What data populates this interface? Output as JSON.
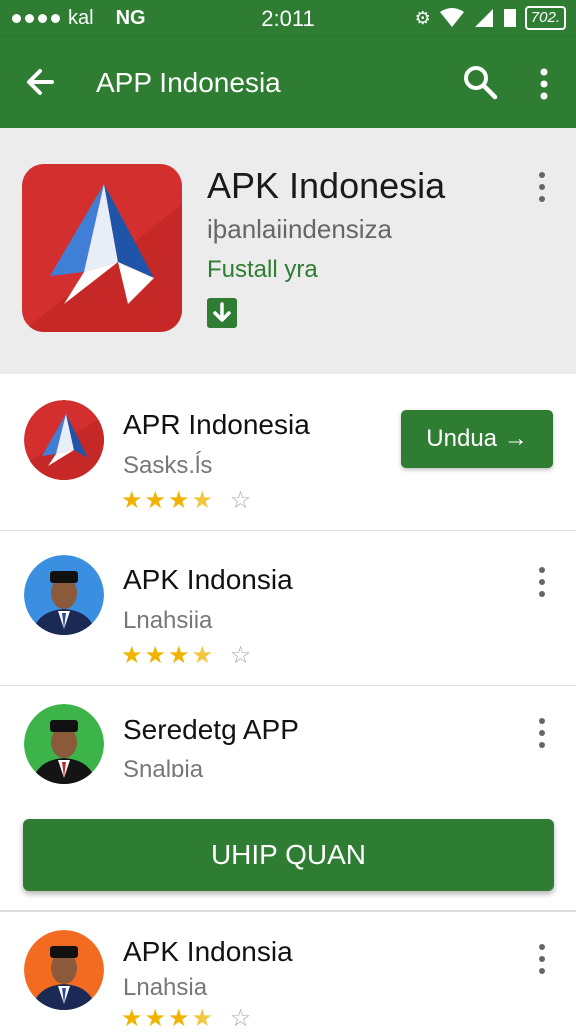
{
  "status_bar": {
    "carrier": "kal",
    "network": "NG",
    "time": "2:011",
    "battery": "702."
  },
  "app_bar": {
    "title": "APP Indonesia",
    "back_icon": "arrow-left-icon",
    "search_icon": "search-icon",
    "more_icon": "more-vert-icon"
  },
  "hero": {
    "name": "APK Indonesia",
    "subtitle": "iþanlaiindensiza",
    "installed_text": "Fustall yra",
    "download_icon": "download-icon"
  },
  "items": [
    {
      "name": "APR Indonesia",
      "subtitle": "Sasks.ĺs",
      "rating": 3.5,
      "button_label": "Undua →"
    },
    {
      "name": "APK Indonsia",
      "subtitle": "Lnahsiia",
      "rating": 3.5
    },
    {
      "name": "Seredetg APP",
      "subtitle": "Snalɒia"
    },
    {
      "name": "APK Indonsia",
      "subtitle": "Lnahsia",
      "rating": 3.5
    }
  ],
  "big_button": {
    "label": "UHIP QUAN"
  },
  "colors": {
    "primary": "#2e7d32",
    "accent_star": "#f0b400",
    "logo_red": "#d32f2f",
    "logo_blue": "#3f7fd6"
  }
}
